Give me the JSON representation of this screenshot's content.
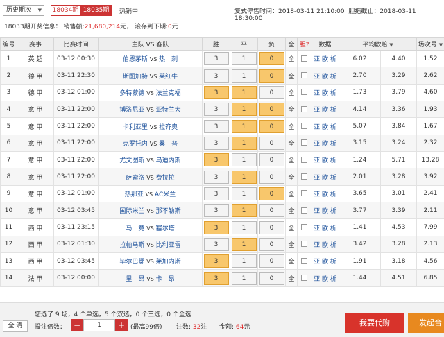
{
  "top": {
    "select_value": "历史期次",
    "period_a": "18034期",
    "period_b": "18035期",
    "hot": "热销中",
    "resume_label": "复式停售时间：",
    "resume_time": "2018-03-11 21:10:00",
    "single_label": "胆拖截止：",
    "single_time": "2018-03-11 18:30:00"
  },
  "result": {
    "label": "18033期开奖信息：",
    "sales_label": "销售额:",
    "sales": "21,680,214",
    "sales_unit": "元，",
    "roll_label": "滚存到下期:",
    "roll": "0",
    "roll_unit": "元"
  },
  "headers": {
    "num": "编号",
    "league": "赛事",
    "time": "比赛时间",
    "teams": "主队 VS 客队",
    "win": "胜",
    "draw": "平",
    "lose": "负",
    "all": "全",
    "dan": "胆?",
    "data": "数据",
    "avg": "平均欧赔",
    "field": "场次号"
  },
  "vs": "VS",
  "all_label": "全",
  "links": {
    "ya": "亚",
    "ou": "欧",
    "xi": "析"
  },
  "matches": [
    {
      "num": "1",
      "league": "英 超",
      "time": "03-12 00:30",
      "home": "伯恩茅斯",
      "away": "热　刺",
      "w": "3",
      "d": "1",
      "l": "0",
      "sel": [
        false,
        false,
        true
      ],
      "o1": "6.02",
      "o2": "4.40",
      "o3": "1.52"
    },
    {
      "num": "2",
      "league": "德 甲",
      "time": "03-11 22:30",
      "home": "斯图加特",
      "away": "莱红牛",
      "w": "3",
      "d": "1",
      "l": "0",
      "sel": [
        false,
        false,
        true
      ],
      "o1": "2.70",
      "o2": "3.29",
      "o3": "2.62"
    },
    {
      "num": "3",
      "league": "德 甲",
      "time": "03-12 01:00",
      "home": "多特蒙德",
      "away": "法兰克福",
      "w": "3",
      "d": "1",
      "l": "0",
      "sel": [
        true,
        true,
        false
      ],
      "o1": "1.73",
      "o2": "3.79",
      "o3": "4.60"
    },
    {
      "num": "4",
      "league": "意 甲",
      "time": "03-11 22:00",
      "home": "博洛尼亚",
      "away": "亚特兰大",
      "w": "3",
      "d": "1",
      "l": "0",
      "sel": [
        false,
        true,
        true
      ],
      "o1": "4.14",
      "o2": "3.36",
      "o3": "1.93"
    },
    {
      "num": "5",
      "league": "意 甲",
      "time": "03-11 22:00",
      "home": "卡利亚里",
      "away": "拉齐奥",
      "w": "3",
      "d": "1",
      "l": "0",
      "sel": [
        false,
        true,
        true
      ],
      "o1": "5.07",
      "o2": "3.84",
      "o3": "1.67"
    },
    {
      "num": "6",
      "league": "意 甲",
      "time": "03-11 22:00",
      "home": "克罗托内",
      "away": "桑　普",
      "w": "3",
      "d": "1",
      "l": "0",
      "sel": [
        false,
        true,
        false
      ],
      "o1": "3.15",
      "o2": "3.24",
      "o3": "2.32"
    },
    {
      "num": "7",
      "league": "意 甲",
      "time": "03-11 22:00",
      "home": "尤文图斯",
      "away": "乌迪内斯",
      "w": "3",
      "d": "1",
      "l": "0",
      "sel": [
        true,
        false,
        false
      ],
      "o1": "1.24",
      "o2": "5.71",
      "o3": "13.28"
    },
    {
      "num": "8",
      "league": "意 甲",
      "time": "03-11 22:00",
      "home": "萨索洛",
      "away": "费拉拉",
      "w": "3",
      "d": "1",
      "l": "0",
      "sel": [
        false,
        true,
        false
      ],
      "o1": "2.01",
      "o2": "3.28",
      "o3": "3.92"
    },
    {
      "num": "9",
      "league": "意 甲",
      "time": "03-12 01:00",
      "home": "热那亚",
      "away": "AC米兰",
      "w": "3",
      "d": "1",
      "l": "0",
      "sel": [
        false,
        false,
        true
      ],
      "o1": "3.65",
      "o2": "3.01",
      "o3": "2.41"
    },
    {
      "num": "10",
      "league": "意 甲",
      "time": "03-12 03:45",
      "home": "国际米兰",
      "away": "那不勒斯",
      "w": "3",
      "d": "1",
      "l": "0",
      "sel": [
        false,
        true,
        false
      ],
      "o1": "3.77",
      "o2": "3.39",
      "o3": "2.11"
    },
    {
      "num": "11",
      "league": "西 甲",
      "time": "03-11 23:15",
      "home": "马　竞",
      "away": "塞尔塔",
      "w": "3",
      "d": "1",
      "l": "0",
      "sel": [
        true,
        false,
        false
      ],
      "o1": "1.41",
      "o2": "4.53",
      "o3": "7.99"
    },
    {
      "num": "12",
      "league": "西 甲",
      "time": "03-12 01:30",
      "home": "拉帕马斯",
      "away": "比利亚雷",
      "w": "3",
      "d": "1",
      "l": "0",
      "sel": [
        false,
        true,
        false
      ],
      "o1": "3.42",
      "o2": "3.28",
      "o3": "2.13"
    },
    {
      "num": "13",
      "league": "西 甲",
      "time": "03-12 03:45",
      "home": "毕尔巴鄂",
      "away": "莱加内斯",
      "w": "3",
      "d": "1",
      "l": "0",
      "sel": [
        true,
        false,
        false
      ],
      "o1": "1.91",
      "o2": "3.18",
      "o3": "4.56"
    },
    {
      "num": "14",
      "league": "法 甲",
      "time": "03-12 00:00",
      "home": "里　昂",
      "away": "卡　昂",
      "w": "3",
      "d": "1",
      "l": "0",
      "sel": [
        true,
        false,
        false
      ],
      "o1": "1.44",
      "o2": "4.51",
      "o3": "6.85"
    }
  ],
  "bottom": {
    "summary": "您选了 9 场，4 个单选，5 个双选，0 个三选，0 个全选",
    "clear": "全 清",
    "mult_label": "投注倍数：",
    "minus": "−",
    "mult": "1",
    "plus": "+",
    "max": "(最高99倍)",
    "notes_label": "注数:",
    "notes": "32",
    "notes_unit": "注",
    "amount_label": "金额:",
    "amount": "64",
    "amount_unit": "元",
    "buy": "我要代购",
    "share": "发起合"
  }
}
